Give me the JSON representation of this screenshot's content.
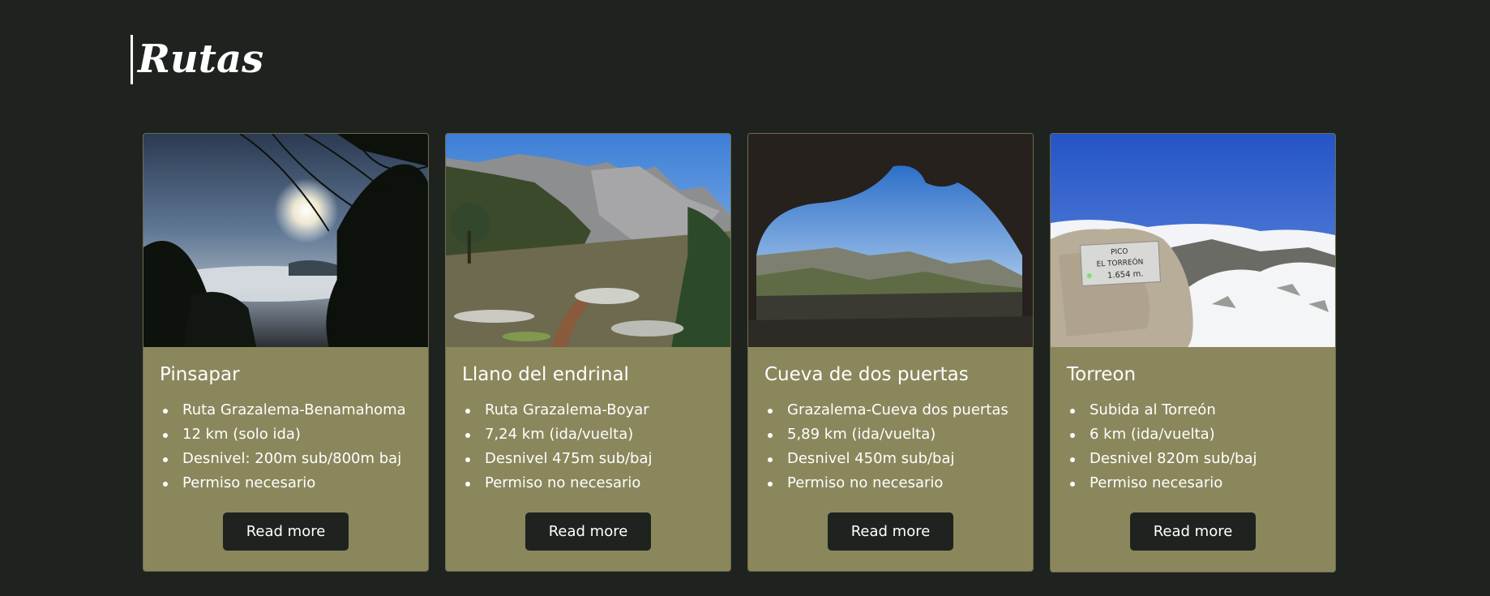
{
  "page": {
    "title": "Rutas"
  },
  "cards": [
    {
      "title": "Pinsapar",
      "details": [
        "Ruta Grazalema-Benamahoma",
        "12 km (solo ida)",
        "Desnivel: 200m sub/800m baj",
        "Permiso necesario"
      ],
      "button": "Read more"
    },
    {
      "title": "Llano del endrinal",
      "details": [
        "Ruta Grazalema-Boyar",
        "7,24 km (ida/vuelta)",
        "Desnivel 475m sub/baj",
        "Permiso no necesario"
      ],
      "button": "Read more"
    },
    {
      "title": "Cueva de dos puertas",
      "details": [
        "Grazalema-Cueva dos puertas",
        "5,89 km (ida/vuelta)",
        "Desnivel 450m sub/baj",
        "Permiso no necesario"
      ],
      "button": "Read more"
    },
    {
      "title": "Torreon",
      "details": [
        "Subida al Torreón",
        "6 km (ida/vuelta)",
        "Desnivel 820m sub/baj",
        "Permiso necesario"
      ],
      "button": "Read more"
    }
  ],
  "photo_sign": {
    "line1": "PICO",
    "line2": "EL TORREÓN",
    "line3": "1.654 m."
  },
  "colors": {
    "background": "#1f231f",
    "card": "#8a875c",
    "button": "#1f231f",
    "text": "#ffffff"
  }
}
